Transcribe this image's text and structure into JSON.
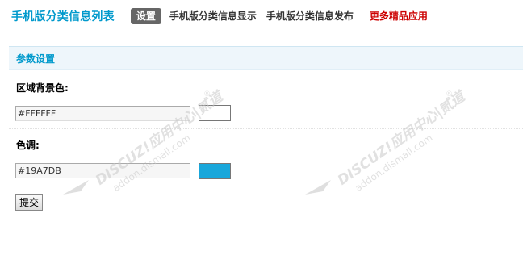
{
  "nav": {
    "title": "手机版分类信息列表",
    "tabs": [
      {
        "label": "设置",
        "active": true
      },
      {
        "label": "手机版分类信息显示",
        "active": false
      },
      {
        "label": "手机版分类信息发布",
        "active": false
      },
      {
        "label": "更多精品应用",
        "active": false,
        "highlight": true
      }
    ]
  },
  "section": {
    "title": "参数设置"
  },
  "form": {
    "fields": [
      {
        "label": "区域背景色:",
        "value": "#FFFFFF",
        "swatch_color": "#FFFFFF"
      },
      {
        "label": "色调:",
        "value": "#19A7DB",
        "swatch_color": "#19A7DB"
      }
    ],
    "submit_label": "提交"
  },
  "watermark": {
    "line1": "DISCUZ!应用中心|贰道",
    "line2": "addon.dismall.com",
    "registered": "®",
    "icon": "discuz-logo-icon"
  },
  "colors": {
    "accent": "#0099CC",
    "highlight": "#CC0000",
    "active_tab_bg": "#666666",
    "section_bg": "#EEF6FB"
  }
}
